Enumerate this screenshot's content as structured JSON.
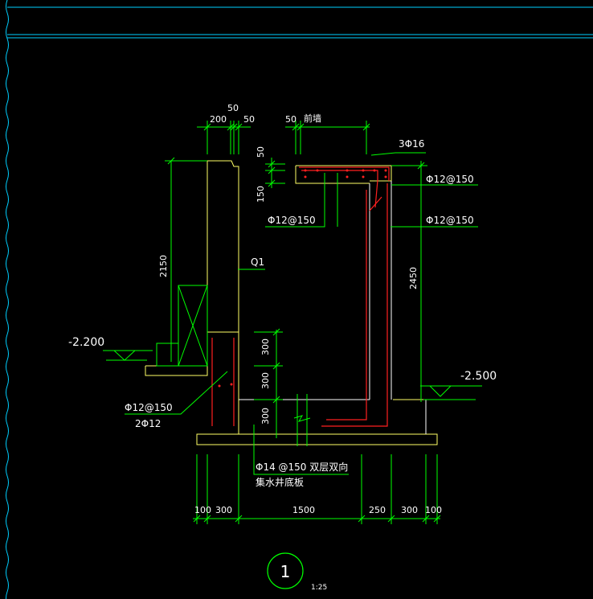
{
  "colors": {
    "background": "#000000",
    "frame": "#00cfff",
    "dimension": "#00ff00",
    "outline": "#ffff66",
    "rebar": "#ff2020",
    "text": "#ffffff",
    "leader": "#00ff00"
  },
  "top_dims": {
    "d200": "200",
    "d50a": "50",
    "d50b": "50",
    "d50c": "50",
    "side": "前墙"
  },
  "left_dims": {
    "d50": "50",
    "d150": "150",
    "h2150": "2150"
  },
  "right_dims": {
    "h2450": "2450"
  },
  "mid_dims": {
    "d300a": "300",
    "d300b": "300",
    "d300c": "300"
  },
  "labels": {
    "top_bar": "3Φ16",
    "right_bar_top": "Φ12@150",
    "right_bar_mid": "Φ12@150",
    "left_bar": "Φ12@150",
    "wall": "Q1",
    "base_bar_a": "Φ12@150",
    "base_bar_b": "2Φ12",
    "slab_bar": "Φ14 @150 双层双向",
    "slab_name": "集水井底板"
  },
  "levels": {
    "left": "-2.200",
    "right": "-2.500"
  },
  "bottom_dims": [
    "100",
    "300",
    "1500",
    "250",
    "300",
    "100"
  ],
  "section": {
    "number": "1",
    "scale": "1:25"
  }
}
